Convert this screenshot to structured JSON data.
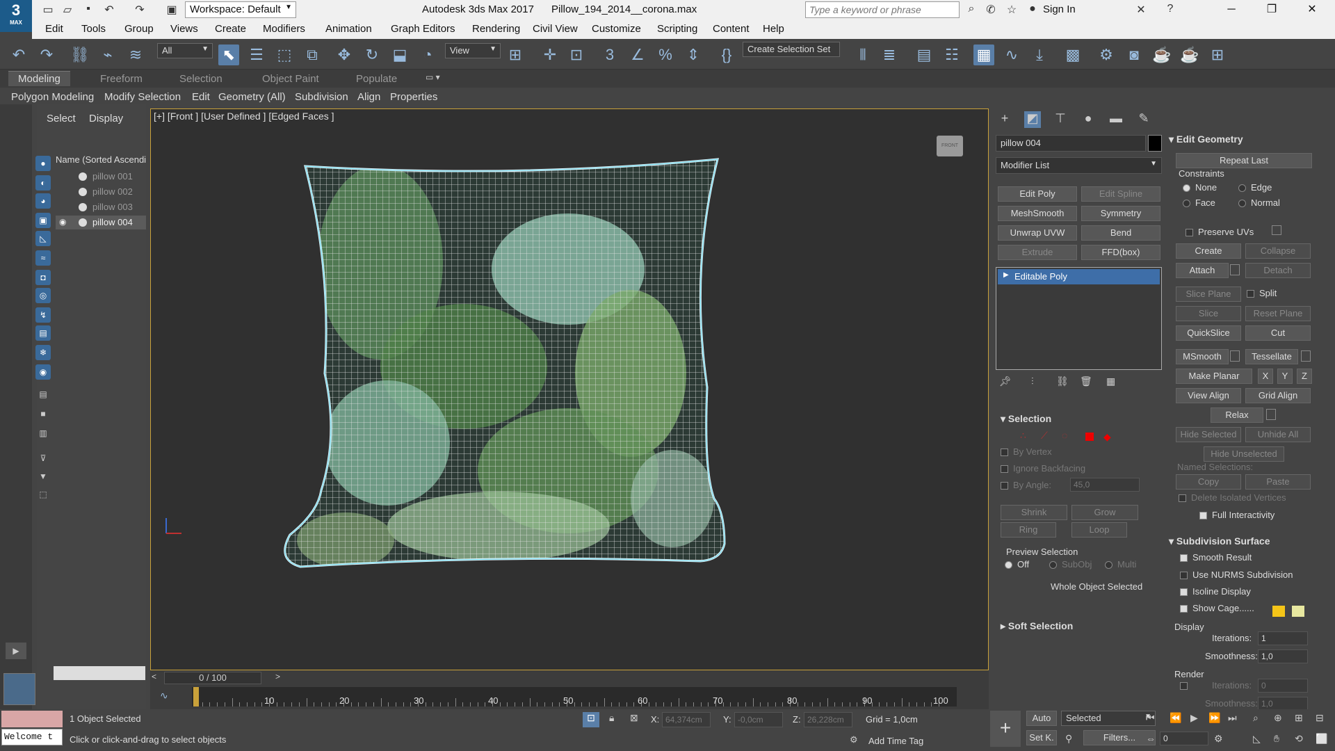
{
  "app": {
    "title": "Autodesk 3ds Max 2017",
    "file": "Pillow_194_2014__corona.max",
    "logo_main": "3",
    "logo_sub": "MAX"
  },
  "workspace": "Workspace: Default",
  "search": {
    "placeholder": "Type a keyword or phrase"
  },
  "signin": "Sign In",
  "menu": [
    "Edit",
    "Tools",
    "Group",
    "Views",
    "Create",
    "Modifiers",
    "Animation",
    "Graph Editors",
    "Rendering",
    "Civil View",
    "Customize",
    "Scripting",
    "Content",
    "Help"
  ],
  "toolbar": {
    "filter": "All",
    "view": "View",
    "selection_set": "Create Selection Set"
  },
  "ribbon": {
    "tabs": [
      "Modeling",
      "Freeform",
      "Selection",
      "Object Paint",
      "Populate"
    ]
  },
  "subribbon": [
    "Polygon Modeling",
    "Modify Selection",
    "Edit",
    "Geometry (All)",
    "Subdivision",
    "Align",
    "Properties"
  ],
  "scene": {
    "tabs": [
      "Select",
      "Display"
    ],
    "column": "Name (Sorted Ascendi",
    "items": [
      {
        "name": "pillow 001",
        "visible": false
      },
      {
        "name": "pillow 002",
        "visible": false
      },
      {
        "name": "pillow 003",
        "visible": false
      },
      {
        "name": "pillow 004",
        "visible": true
      }
    ]
  },
  "viewport": {
    "label": "[+] [Front ] [User Defined ] [Edged Faces ]",
    "navcube": "FRONT"
  },
  "command": {
    "object_name": "pillow 004",
    "modifier_list": "Modifier List",
    "buttons": [
      "Edit Poly",
      "Edit Spline",
      "MeshSmooth",
      "Symmetry",
      "Unwrap UVW",
      "Bend",
      "Extrude",
      "FFD(box)"
    ],
    "stack_item": "Editable Poly"
  },
  "selection_rollout": {
    "title": "Selection",
    "by_vertex": "By Vertex",
    "ignore_backfacing": "Ignore Backfacing",
    "by_angle": "By Angle:",
    "angle_value": "45,0",
    "shrink": "Shrink",
    "grow": "Grow",
    "ring": "Ring",
    "loop": "Loop",
    "preview": "Preview Selection",
    "off": "Off",
    "subobj": "SubObj",
    "multi": "Multi",
    "status": "Whole Object Selected",
    "soft": "Soft Selection"
  },
  "edit_geometry": {
    "title": "Edit Geometry",
    "repeat_last": "Repeat Last",
    "constraints": "Constraints",
    "none": "None",
    "edge": "Edge",
    "face": "Face",
    "normal": "Normal",
    "preserve_uvs": "Preserve UVs",
    "create": "Create",
    "collapse": "Collapse",
    "attach": "Attach",
    "detach": "Detach",
    "slice_plane": "Slice Plane",
    "split": "Split",
    "slice": "Slice",
    "reset_plane": "Reset Plane",
    "quickslice": "QuickSlice",
    "cut": "Cut",
    "msmooth": "MSmooth",
    "tessellate": "Tessellate",
    "make_planar": "Make Planar",
    "x": "X",
    "y": "Y",
    "z": "Z",
    "view_align": "View Align",
    "grid_align": "Grid Align",
    "relax": "Relax",
    "hide_selected": "Hide Selected",
    "unhide_all": "Unhide All",
    "hide_unselected": "Hide Unselected",
    "named_sel": "Named Selections:",
    "copy": "Copy",
    "paste": "Paste",
    "delete_iso": "Delete Isolated Vertices",
    "full_inter": "Full Interactivity"
  },
  "subdivision": {
    "title": "Subdivision Surface",
    "smooth_result": "Smooth Result",
    "use_nurms": "Use NURMS Subdivision",
    "isoline": "Isoline Display",
    "show_cage": "Show Cage......",
    "display": "Display",
    "iterations_label": "Iterations:",
    "iterations": "1",
    "smoothness_label": "Smoothness:",
    "smoothness": "1,0",
    "render": "Render",
    "r_iterations": "0",
    "r_smoothness_label": "Smoothness:",
    "r_smoothness": "1,0",
    "cage_color1": "#f5c518",
    "cage_color2": "#e8e8a0"
  },
  "timeline": {
    "frame": "0 / 100",
    "ticks": [
      "10",
      "20",
      "30",
      "40",
      "50",
      "60",
      "70",
      "80",
      "90",
      "100"
    ]
  },
  "status": {
    "objects": "1 Object Selected",
    "hint": "Click or click-and-drag to select objects",
    "welcome": "Welcome t",
    "x_label": "X:",
    "x": "64,374cm",
    "y_label": "Y:",
    "y": "-0,0cm",
    "z_label": "Z:",
    "z": "26,228cm",
    "grid": "Grid = 1,0cm",
    "add_time_tag": "Add Time Tag",
    "auto": "Auto",
    "setk": "Set K.",
    "selected": "Selected",
    "filters": "Filters...",
    "frame_field": "0"
  }
}
